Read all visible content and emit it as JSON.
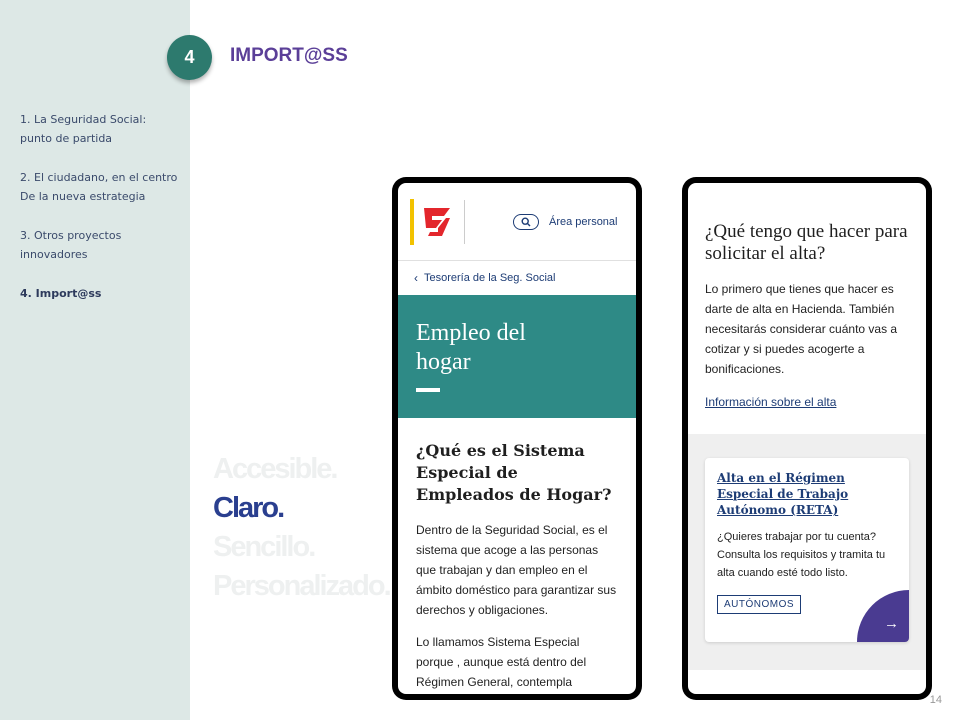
{
  "header": {
    "badge": "4",
    "title": "IMPORT@SS"
  },
  "sidebar": {
    "items": [
      {
        "line1": "1. La Seguridad Social:",
        "line2": "punto de partida"
      },
      {
        "line1": "2. El ciudadano, en el centro",
        "line2": "De la nueva estrategia"
      },
      {
        "line1": "3. Otros proyectos",
        "line2": "innovadores"
      },
      {
        "line1": "4. Import@ss",
        "line2": ""
      }
    ]
  },
  "tagline": {
    "l1": "Accesible.",
    "l2": "Claro.",
    "l3": "Sencillo.",
    "l4": "Personalizado."
  },
  "phone1": {
    "area_personal": "Área personal",
    "breadcrumb": "Tesorería de la Seg. Social",
    "hero_title": "Empleo del hogar",
    "question": "¿Qué es el Sistema Especial de Empleados de Hogar?",
    "para1": "Dentro de la Seguridad Social, es el sistema que acoge a las personas que trabajan y dan empleo en el ámbito doméstico para garantizar sus derechos y obligaciones.",
    "para2": "Lo llamamos Sistema Especial porque , aunque está dentro del Régimen General, contempla"
  },
  "phone2": {
    "question": "¿Qué tengo que hacer para solicitar el alta?",
    "para": "Lo primero que tienes que hacer es darte de alta en Hacienda. También necesitarás considerar cuánto vas a cotizar y si puedes acogerte a bonificaciones.",
    "link": "Información sobre el alta",
    "card_title": "Alta en el Régimen Especial de Trabajo Autónomo (RETA)",
    "card_text": "¿Quieres trabajar por tu cuenta? Consulta los requisitos y tramita tu alta cuando esté todo listo.",
    "tag": "AUTÓNOMOS",
    "arrow": "→"
  },
  "page_number": "14",
  "colors": {
    "sidebar": "#dde8e6",
    "badge": "#2d7a6e",
    "title": "#5b3f98",
    "hero": "#2e8a86",
    "accent": "#4a3b91"
  }
}
